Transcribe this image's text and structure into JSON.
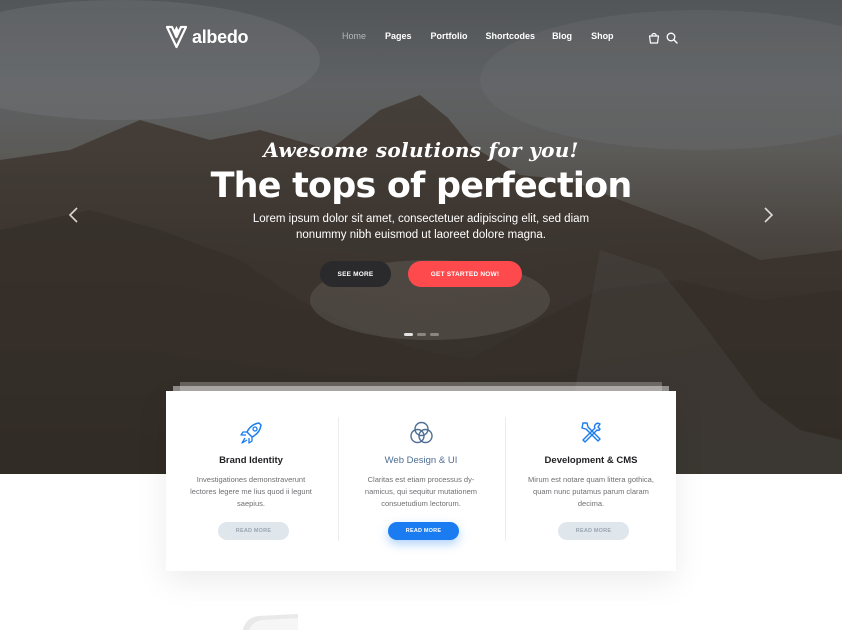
{
  "brand": {
    "name": "albedo"
  },
  "nav": {
    "items": [
      {
        "label": "Home",
        "active": true
      },
      {
        "label": "Pages"
      },
      {
        "label": "Portfolio"
      },
      {
        "label": "Shortcodes"
      },
      {
        "label": "Blog"
      },
      {
        "label": "Shop"
      }
    ],
    "icons": [
      "cart-icon",
      "search-icon"
    ]
  },
  "hero": {
    "tagline": "Awesome solutions for you!",
    "headline": "The tops of perfection",
    "text_line1": "Lorem ipsum dolor sit amet, consectetuer adipiscing elit, sed diam",
    "text_line2": "nonummy nibh euismod ut laoreet dolore magna.",
    "see_more_label": "SEE MORE",
    "get_started_label": "GET STARTED NOW!",
    "slides": 3,
    "active_slide": 1
  },
  "features": [
    {
      "icon": "rocket-icon",
      "title": "Brand Identity",
      "desc": "Investigationes demonstraverunt lectores legere me lius quod ii legunt saepius.",
      "button": "READ MORE"
    },
    {
      "icon": "circles-icon",
      "title": "Web Design & UI",
      "desc": "Claritas est etiam processus dy-namicus, qui sequitur mutationem consuetudium lectorum.",
      "button": "READ MORE"
    },
    {
      "icon": "tools-icon",
      "title": "Development & CMS",
      "desc": "Mirum est notare quam littera gothica, quam nunc putamus parum claram decima.",
      "button": "READ MORE"
    }
  ],
  "colors": {
    "accent_red": "#ff4a4d",
    "accent_blue": "#1a7cf0",
    "dark_button": "#2a2a2c"
  }
}
